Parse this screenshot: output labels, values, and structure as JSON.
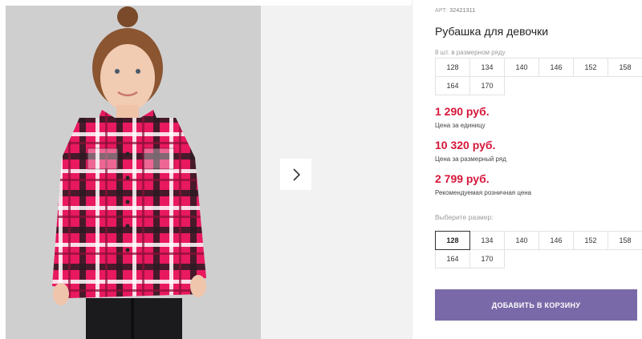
{
  "product": {
    "article_label": "АРТ:",
    "article_number": "32421311",
    "title": "Рубашка для девочки",
    "pack_note": "8 шт. в размерном ряду",
    "pack_sizes": [
      "128",
      "134",
      "140",
      "146",
      "152",
      "158",
      "164",
      "170"
    ],
    "prices": {
      "unit_price": "1 290 руб.",
      "unit_label": "Цена за единицу",
      "pack_price": "10 320 руб.",
      "pack_label": "Цена за размерный ряд",
      "retail_price": "2 799 руб.",
      "retail_label": "Рекомендуемая розничная цена"
    },
    "choose_size_label": "Выберите размер:",
    "size_options": [
      "128",
      "134",
      "140",
      "146",
      "152",
      "158",
      "164",
      "170"
    ],
    "selected_size": "128",
    "add_to_cart_label": "ДОБАВИТЬ В КОРЗИНУ"
  },
  "gallery": {
    "next_icon": "chevron-right-icon",
    "photo_subject": "girl-in-pink-plaid-shirt"
  },
  "colors": {
    "price_red": "#d6173a",
    "cart_button": "#7a69a8",
    "shirt_pink": "#e8195f"
  }
}
